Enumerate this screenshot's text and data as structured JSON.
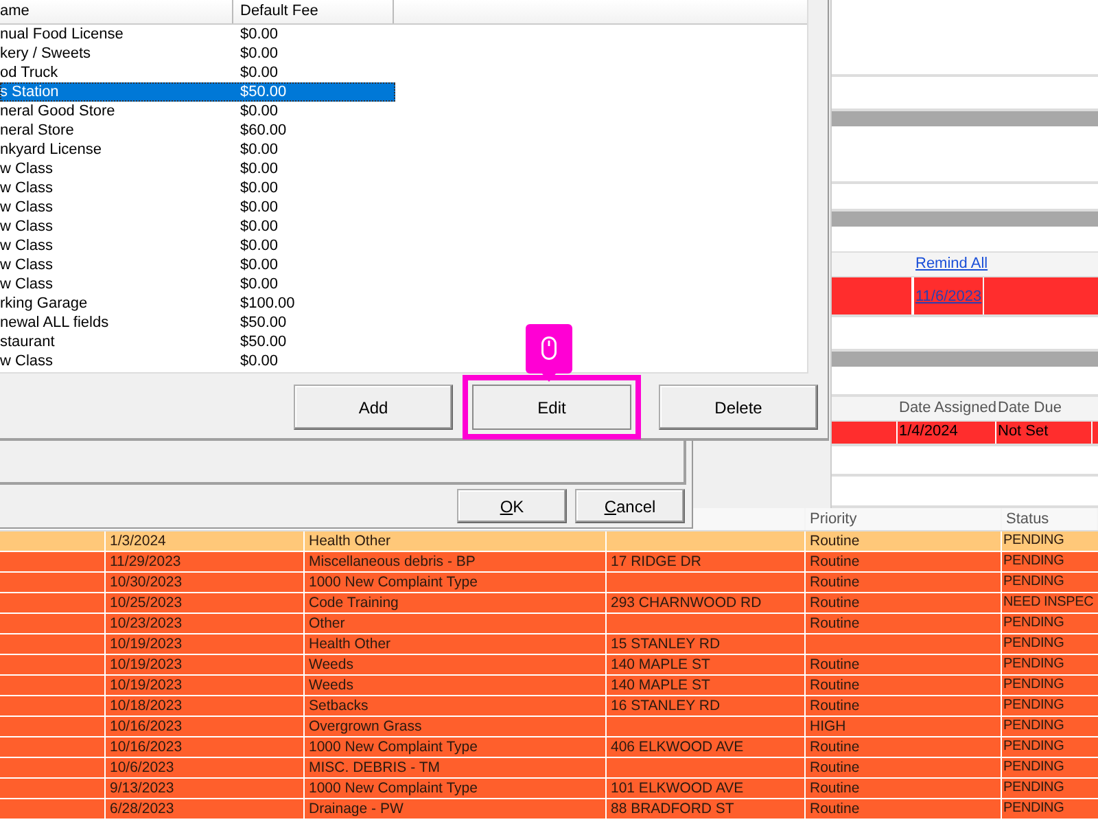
{
  "fee_list": {
    "columns": [
      "ame",
      "Default Fee"
    ],
    "rows": [
      {
        "name": "nual Food License",
        "fee": "$0.00",
        "selected": false
      },
      {
        "name": "kery / Sweets",
        "fee": "$0.00",
        "selected": false
      },
      {
        "name": "od Truck",
        "fee": "$0.00",
        "selected": false
      },
      {
        "name": "s Station",
        "fee": "$50.00",
        "selected": true
      },
      {
        "name": "neral Good Store",
        "fee": "$0.00",
        "selected": false
      },
      {
        "name": "neral Store",
        "fee": "$60.00",
        "selected": false
      },
      {
        "name": "nkyard License",
        "fee": "$0.00",
        "selected": false
      },
      {
        "name": "w Class",
        "fee": "$0.00",
        "selected": false
      },
      {
        "name": "w Class",
        "fee": "$0.00",
        "selected": false
      },
      {
        "name": "w Class",
        "fee": "$0.00",
        "selected": false
      },
      {
        "name": "w Class",
        "fee": "$0.00",
        "selected": false
      },
      {
        "name": "w Class",
        "fee": "$0.00",
        "selected": false
      },
      {
        "name": "w Class",
        "fee": "$0.00",
        "selected": false
      },
      {
        "name": "w Class",
        "fee": "$0.00",
        "selected": false
      },
      {
        "name": "rking Garage",
        "fee": "$100.00",
        "selected": false
      },
      {
        "name": "newal ALL fields",
        "fee": "$50.00",
        "selected": false
      },
      {
        "name": "staurant",
        "fee": "$50.00",
        "selected": false
      },
      {
        "name": "w Class",
        "fee": "$0.00",
        "selected": false
      }
    ]
  },
  "list_buttons": [
    {
      "label": "Add",
      "highlighted": false
    },
    {
      "label": "Edit",
      "highlighted": true
    },
    {
      "label": "Delete",
      "highlighted": false
    }
  ],
  "dialog_buttons": [
    {
      "access_key": "O",
      "rest": "K"
    },
    {
      "access_key": "C",
      "rest": "ancel"
    }
  ],
  "side_panel": {
    "reminders": {
      "link": "Remind All",
      "rows": [
        {
          "date": "11/6/2023"
        }
      ]
    },
    "assignments": {
      "columns": [
        "Date Assigned",
        "Date Due"
      ],
      "rows": [
        {
          "date_assigned": "1/4/2024",
          "date_due": "Not Set"
        }
      ]
    }
  },
  "complaints": {
    "columns": [
      "Priority",
      "Status"
    ],
    "rows": [
      {
        "date": "1/3/2024",
        "type": "Health Other",
        "address": "",
        "priority": "Routine",
        "status": "PENDING",
        "selected": true
      },
      {
        "date": "11/29/2023",
        "type": "Miscellaneous debris - BP",
        "address": "17 RIDGE DR",
        "priority": "Routine",
        "status": "PENDING",
        "selected": false
      },
      {
        "date": "10/30/2023",
        "type": "1000 New Complaint Type",
        "address": "",
        "priority": "Routine",
        "status": "PENDING",
        "selected": false
      },
      {
        "date": "10/25/2023",
        "type": "Code Training",
        "address": "293 CHARNWOOD RD",
        "priority": "Routine",
        "status": "NEED INSPEC",
        "selected": false
      },
      {
        "date": "10/23/2023",
        "type": "Other",
        "address": "",
        "priority": "Routine",
        "status": "PENDING",
        "selected": false
      },
      {
        "date": "10/19/2023",
        "type": "Health Other",
        "address": "15 STANLEY RD",
        "priority": "",
        "status": "PENDING",
        "selected": false
      },
      {
        "date": "10/19/2023",
        "type": "Weeds",
        "address": "140 MAPLE ST",
        "priority": "Routine",
        "status": "PENDING",
        "selected": false
      },
      {
        "date": "10/19/2023",
        "type": "Weeds",
        "address": "140 MAPLE ST",
        "priority": "Routine",
        "status": "PENDING",
        "selected": false
      },
      {
        "date": "10/18/2023",
        "type": "Setbacks",
        "address": "16 STANLEY RD",
        "priority": "Routine",
        "status": "PENDING",
        "selected": false
      },
      {
        "date": "10/16/2023",
        "type": "Overgrown Grass",
        "address": "",
        "priority": "HIGH",
        "status": "PENDING",
        "selected": false
      },
      {
        "date": "10/16/2023",
        "type": "1000 New Complaint Type",
        "address": "406 ELKWOOD AVE",
        "priority": "Routine",
        "status": "PENDING",
        "selected": false
      },
      {
        "date": "10/6/2023",
        "type": "MISC. DEBRIS - TM",
        "address": "",
        "priority": "Routine",
        "status": "PENDING",
        "selected": false
      },
      {
        "date": "9/13/2023",
        "type": "1000 New Complaint Type",
        "address": "101 ELKWOOD AVE",
        "priority": "Routine",
        "status": "PENDING",
        "selected": false
      },
      {
        "date": "6/28/2023",
        "type": "Drainage - PW",
        "address": "88 BRADFORD ST",
        "priority": "Routine",
        "status": "PENDING",
        "selected": false
      }
    ]
  }
}
